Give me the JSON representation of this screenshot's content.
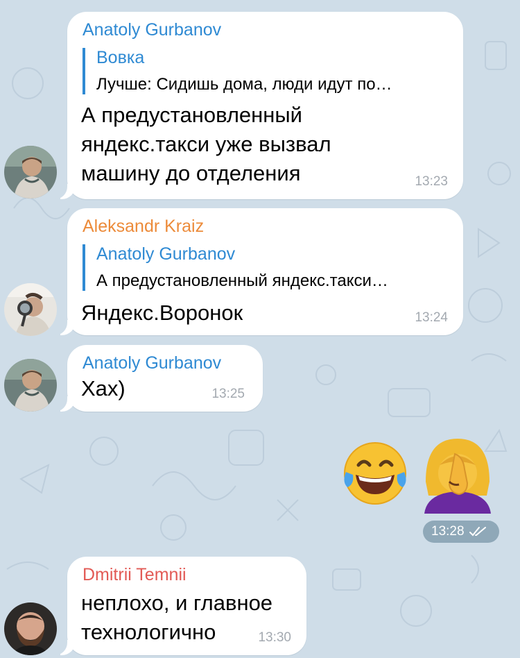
{
  "colors": {
    "background": "#cfdde8",
    "bubble": "#ffffff",
    "sender_blue": "#2f8ad3",
    "sender_orange": "#ec8b3a",
    "sender_red": "#e25a55",
    "time_gray": "#a3a9b0"
  },
  "messages": [
    {
      "sender": "Anatoly Gurbanov",
      "reply": {
        "name": "Вовка",
        "text": "Лучше: Сидишь дома, люди идут по…"
      },
      "text": "А предустановленный\nяндекс.такси уже вызвал\nмашину до отделения",
      "time": "13:23",
      "avatar": "avatar-anatoly"
    },
    {
      "sender": "Aleksandr Kraiz",
      "reply": {
        "name": "Anatoly Gurbanov",
        "text": "А предустановленный яндекс.такси…"
      },
      "text": "Яндекс.Воронок",
      "time": "13:24",
      "avatar": "avatar-aleksandr"
    },
    {
      "sender": "Anatoly Gurbanov",
      "text": "Хах)",
      "time": "13:25",
      "avatar": "avatar-anatoly"
    },
    {
      "outgoing": true,
      "emojis": [
        "tears-of-joy-emoji",
        "facepalm-woman-emoji"
      ],
      "time": "13:28",
      "status": "read-checkmarks-icon"
    },
    {
      "sender": "Dmitrii Temnii",
      "text": "неплохо, и главное\nтехнологично",
      "time": "13:30",
      "avatar": "avatar-dmitrii"
    }
  ]
}
